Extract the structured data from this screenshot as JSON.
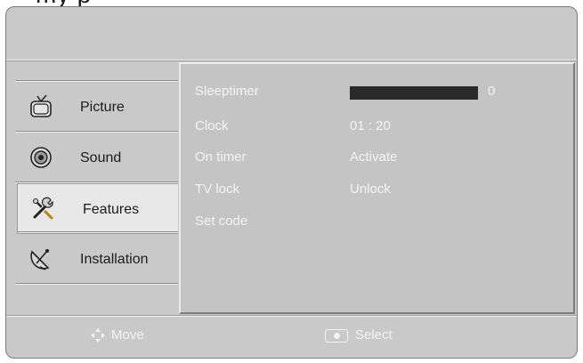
{
  "header": {
    "partial_title": "my  p"
  },
  "sidebar": {
    "items": [
      {
        "label": "Picture",
        "icon": "tv-icon",
        "active": false
      },
      {
        "label": "Sound",
        "icon": "speaker-icon",
        "active": false
      },
      {
        "label": "Features",
        "icon": "tools-icon",
        "active": true
      },
      {
        "label": "Installation",
        "icon": "satellite-dish-icon",
        "active": false
      }
    ]
  },
  "menu": {
    "sleeptimer": {
      "label": "Sleeptimer",
      "value": "0",
      "level": 0
    },
    "clock": {
      "label": "Clock",
      "value": "01 : 20"
    },
    "on_timer": {
      "label": "On timer",
      "value": "Activate"
    },
    "tv_lock": {
      "label": "TV lock",
      "value": "Unlock"
    },
    "set_code": {
      "label": "Set code"
    }
  },
  "footer": {
    "move_label": "Move",
    "select_label": "Select"
  },
  "colors": {
    "panel_bg": "#c9c9c9",
    "content_bg": "#c4c4c4",
    "active_item_bg": "#e8e8e8",
    "text_light": "#f4f4f4",
    "text_dark": "#1c1c1c"
  }
}
